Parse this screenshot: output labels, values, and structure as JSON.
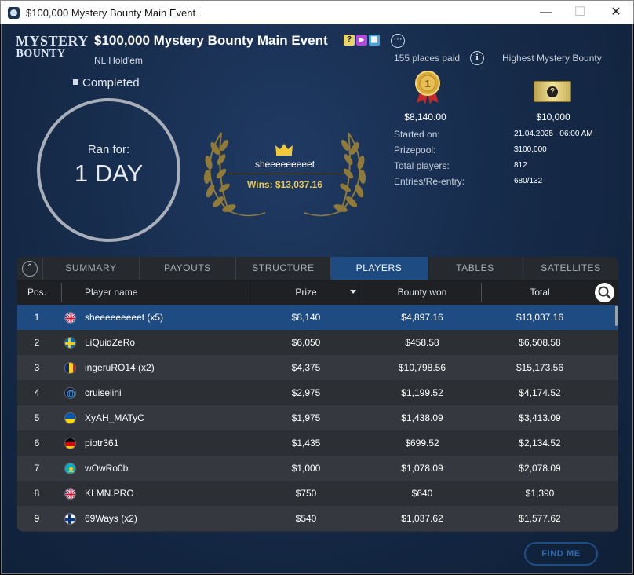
{
  "window": {
    "title": "$100,000 Mystery Bounty Main Event",
    "minimize_glyph": "—",
    "maximize_glyph": "☐",
    "close_glyph": "✕"
  },
  "logo": {
    "line1": "MYSTERY",
    "line2": "BOUNTY"
  },
  "event": {
    "title": "$100,000 Mystery Bounty Main Event",
    "game_type": "NL Hold'em",
    "status": "Completed",
    "more_glyph": "···",
    "badges": [
      {
        "icon": "mystery-icon",
        "glyph": "?",
        "color": "#e8d46a"
      },
      {
        "icon": "video-icon",
        "glyph": "▶",
        "color": "#b04ad8"
      },
      {
        "icon": "calendar-icon",
        "glyph": "▦",
        "color": "#4aa3e0"
      }
    ]
  },
  "ran_for": {
    "label": "Ran for:",
    "value": "1 DAY"
  },
  "winner": {
    "name": "sheeeeeeeeet",
    "wins": "Wins: $13,037.16"
  },
  "summary": {
    "places_paid": "155 places paid",
    "info_glyph": "i",
    "highest_bounty_label": "Highest Mystery Bounty",
    "first_prize": "$8,140.00",
    "medal_number": "1",
    "highest_bounty": "$10,000",
    "ticket_glyph": "?",
    "info_rows": [
      {
        "label": "Started on:",
        "value": "21.04.2025   06:00 AM"
      },
      {
        "label": "Prizepool:",
        "value": "$100,000"
      },
      {
        "label": "Total players:",
        "value": "812"
      },
      {
        "label": "Entries/Re-entry:",
        "value": "680/132"
      }
    ]
  },
  "tabs": {
    "collapse_glyph": "⌃",
    "items": [
      "SUMMARY",
      "PAYOUTS",
      "STRUCTURE",
      "PLAYERS",
      "TABLES",
      "SATELLITES"
    ],
    "active": "PLAYERS"
  },
  "table": {
    "headers": {
      "pos": "Pos.",
      "name": "Player name",
      "prize": "Prize",
      "bounty": "Bounty won",
      "total": "Total"
    },
    "rows": [
      {
        "pos": "1",
        "flag": "gb",
        "name": "sheeeeeeeeet (x5)",
        "prize": "$8,140",
        "bounty": "$4,897.16",
        "total": "$13,037.16"
      },
      {
        "pos": "2",
        "flag": "se",
        "name": "LiQuidZeRo",
        "prize": "$6,050",
        "bounty": "$458.58",
        "total": "$6,508.58"
      },
      {
        "pos": "3",
        "flag": "ro",
        "name": "ingeruRO14 (x2)",
        "prize": "$4,375",
        "bounty": "$10,798.56",
        "total": "$15,173.56"
      },
      {
        "pos": "4",
        "flag": "globe",
        "name": "cruiselini",
        "prize": "$2,975",
        "bounty": "$1,199.52",
        "total": "$4,174.52"
      },
      {
        "pos": "5",
        "flag": "ua",
        "name": "XyAH_MATyC",
        "prize": "$1,975",
        "bounty": "$1,438.09",
        "total": "$3,413.09"
      },
      {
        "pos": "6",
        "flag": "de",
        "name": "piotr361",
        "prize": "$1,435",
        "bounty": "$699.52",
        "total": "$2,134.52"
      },
      {
        "pos": "7",
        "flag": "kz",
        "name": "wOwRo0b",
        "prize": "$1,000",
        "bounty": "$1,078.09",
        "total": "$2,078.09"
      },
      {
        "pos": "8",
        "flag": "gb",
        "name": "KLMN.PRO",
        "prize": "$750",
        "bounty": "$640",
        "total": "$1,390"
      },
      {
        "pos": "9",
        "flag": "fi",
        "name": "69Ways (x2)",
        "prize": "$540",
        "bounty": "$1,037.62",
        "total": "$1,577.62"
      }
    ]
  },
  "find_me": "FIND ME",
  "colors": {
    "accent_blue": "#1d4b82",
    "gold": "#e9c84d"
  }
}
